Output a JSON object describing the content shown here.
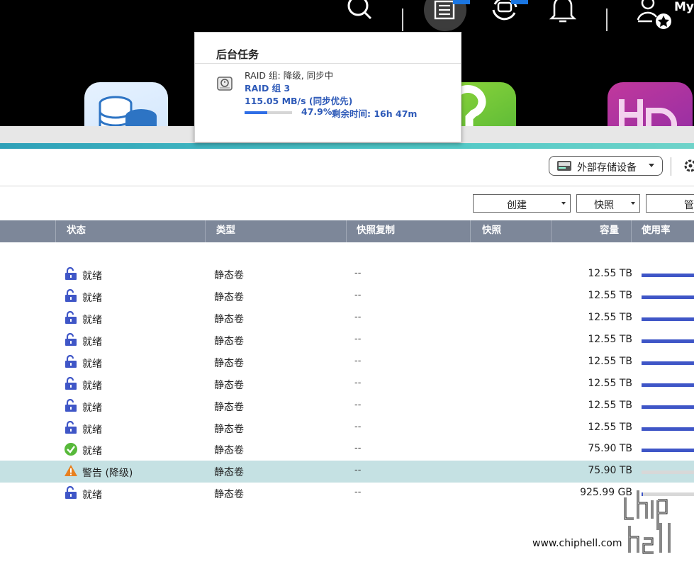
{
  "topbar": {
    "user_label": "My",
    "icons": [
      "search-icon",
      "tasks-icon",
      "sync-icon",
      "bell-icon",
      "user-icon"
    ]
  },
  "popup": {
    "title": "后台任务",
    "task": {
      "name": "RAID 组: 降级, 同步中",
      "group": "RAID 组 3",
      "speed": "115.05 MB/s (同步优先)",
      "progress_text": "47.9%",
      "progress_value": 0.479,
      "remaining": "剩余时间:  16h 47m"
    }
  },
  "toolbar": {
    "external_storage": "外部存储设备",
    "create": "创建",
    "snapshot": "快照",
    "manage": "管"
  },
  "table": {
    "columns": {
      "status": "状态",
      "type": "类型",
      "replica": "快照复制",
      "snapshot": "快照",
      "capacity": "容量",
      "usage": "使用率"
    },
    "rows": [
      {
        "status_icon": "lock-icon",
        "status": "就绪",
        "type": "静态卷",
        "replica": "--",
        "capacity": "12.55 TB",
        "usage_fill": 1.0,
        "usage_color": "#3f56c7"
      },
      {
        "status_icon": "lock-icon",
        "status": "就绪",
        "type": "静态卷",
        "replica": "--",
        "capacity": "12.55 TB",
        "usage_fill": 1.0,
        "usage_color": "#3f56c7"
      },
      {
        "status_icon": "lock-icon",
        "status": "就绪",
        "type": "静态卷",
        "replica": "--",
        "capacity": "12.55 TB",
        "usage_fill": 1.0,
        "usage_color": "#3f56c7"
      },
      {
        "status_icon": "lock-icon",
        "status": "就绪",
        "type": "静态卷",
        "replica": "--",
        "capacity": "12.55 TB",
        "usage_fill": 1.0,
        "usage_color": "#3f56c7"
      },
      {
        "status_icon": "lock-icon",
        "status": "就绪",
        "type": "静态卷",
        "replica": "--",
        "capacity": "12.55 TB",
        "usage_fill": 1.0,
        "usage_color": "#3f56c7"
      },
      {
        "status_icon": "lock-icon",
        "status": "就绪",
        "type": "静态卷",
        "replica": "--",
        "capacity": "12.55 TB",
        "usage_fill": 1.0,
        "usage_color": "#3f56c7"
      },
      {
        "status_icon": "lock-icon",
        "status": "就绪",
        "type": "静态卷",
        "replica": "--",
        "capacity": "12.55 TB",
        "usage_fill": 1.0,
        "usage_color": "#3f56c7"
      },
      {
        "status_icon": "lock-icon",
        "status": "就绪",
        "type": "静态卷",
        "replica": "--",
        "capacity": "12.55 TB",
        "usage_fill": 1.0,
        "usage_color": "#3f56c7"
      },
      {
        "status_icon": "check-icon",
        "status": "就绪",
        "type": "静态卷",
        "replica": "--",
        "capacity": "75.90 TB",
        "usage_fill": 1.0,
        "usage_color": "#3f56c7"
      },
      {
        "status_icon": "warning-icon",
        "status": "警告 (降级)",
        "type": "静态卷",
        "replica": "--",
        "capacity": "75.90 TB",
        "usage_fill": 0.0,
        "usage_color": "#3f56c7",
        "selected": true
      },
      {
        "status_icon": "lock-icon",
        "status": "就绪",
        "type": "静态卷",
        "replica": "--",
        "capacity": "925.99 GB",
        "usage_fill": 0.03,
        "usage_color": "#3f56c7"
      }
    ]
  },
  "watermark": {
    "url": "www.chiphell.com",
    "logo": "chip hell"
  },
  "colors": {
    "accent_blue": "#2e5ab8",
    "header_bg": "#7d8799",
    "selected_row": "#c5e1e3",
    "usage_bar": "#3f56c7"
  }
}
